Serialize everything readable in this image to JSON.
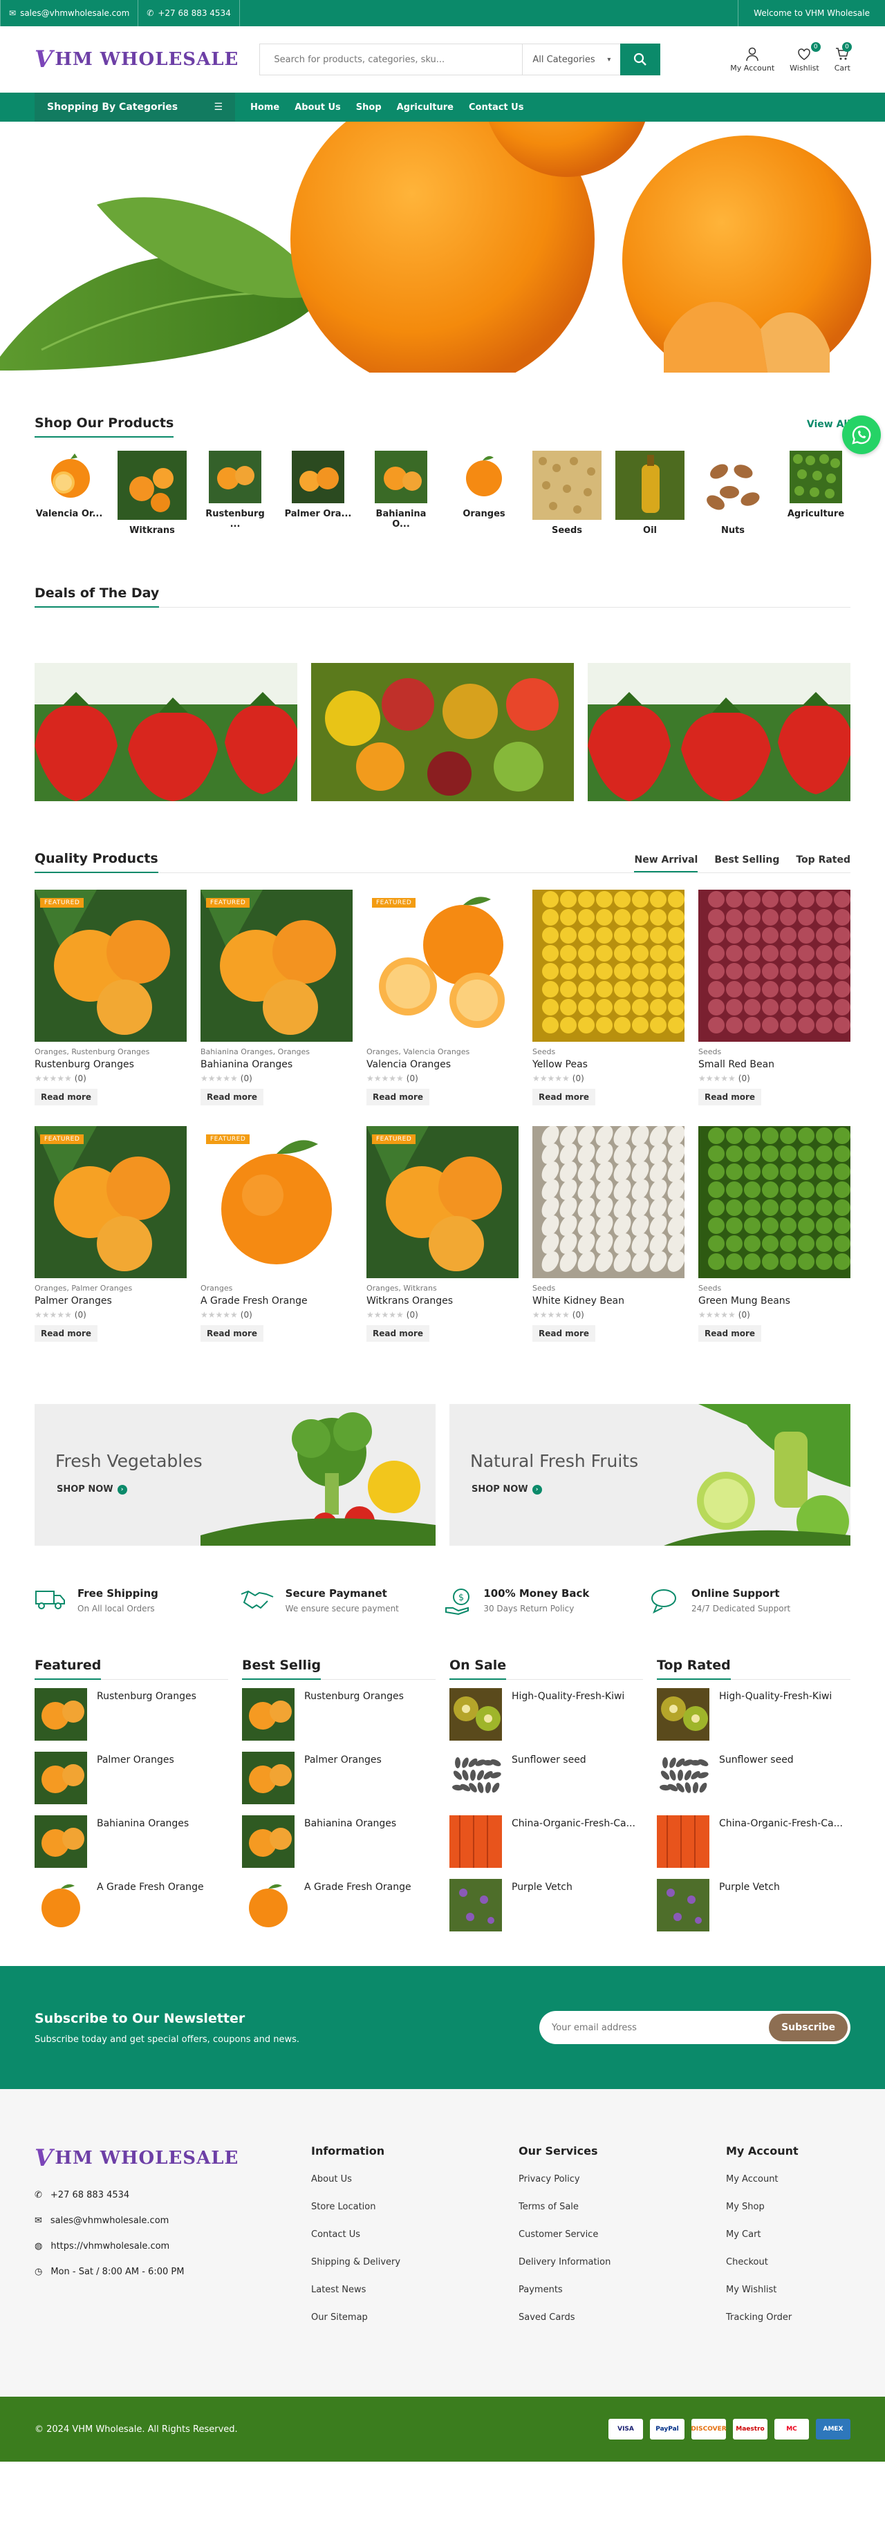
{
  "topbar": {
    "email": "sales@vhmwholesale.com",
    "phone": "+27 68 883 4534",
    "welcome": "Welcome to VHM Wholesale"
  },
  "header": {
    "logo_text": "HM WHOLESALE",
    "logo_initial": "V",
    "search_placeholder": "Search for products, categories, sku...",
    "category_select": "All Categories",
    "account_label": "My Account",
    "wishlist_label": "Wishlist",
    "wishlist_count": "0",
    "cart_label": "Cart",
    "cart_count": "0"
  },
  "nav": {
    "categories_button": "Shopping By Categories",
    "links": [
      "Home",
      "About Us",
      "Shop",
      "Agriculture",
      "Contact Us"
    ]
  },
  "shop_products": {
    "title": "Shop Our Products",
    "view_all": "View All",
    "items": [
      {
        "label": "Valencia Or...",
        "img": "orange-halves"
      },
      {
        "label": "Witkrans",
        "img": "orange-tree"
      },
      {
        "label": "Rustenburg ...",
        "img": "orange-tree"
      },
      {
        "label": "Palmer Ora...",
        "img": "orange-tree"
      },
      {
        "label": "Bahianina O...",
        "img": "orange-tree"
      },
      {
        "label": "Oranges",
        "img": "single-orange"
      },
      {
        "label": "Seeds",
        "img": "seeds"
      },
      {
        "label": "Oil",
        "img": "oil"
      },
      {
        "label": "Nuts",
        "img": "nuts"
      },
      {
        "label": "Agriculture",
        "img": "peas"
      }
    ]
  },
  "deals": {
    "title": "Deals of The Day"
  },
  "quality": {
    "title": "Quality Products",
    "tabs": [
      "New Arrival",
      "Best Selling",
      "Top Rated"
    ],
    "products": [
      {
        "featured": "FEATURED",
        "cats": "Oranges, Rustenburg Oranges",
        "name": "Rustenburg Oranges",
        "reviews": "(0)",
        "button": "Read more",
        "img": "tree"
      },
      {
        "featured": "FEATURED",
        "cats": "Bahianina Oranges, Oranges",
        "name": "Bahianina Oranges",
        "reviews": "(0)",
        "button": "Read more",
        "img": "tree"
      },
      {
        "featured": "FEATURED",
        "cats": "Oranges, Valencia Oranges",
        "name": "Valencia Oranges",
        "reviews": "(0)",
        "button": "Read more",
        "img": "halves"
      },
      {
        "featured": "",
        "cats": "Seeds",
        "name": "Yellow Peas",
        "reviews": "(0)",
        "button": "Read more",
        "img": "yellowpeas"
      },
      {
        "featured": "",
        "cats": "Seeds",
        "name": "Small Red Bean",
        "reviews": "(0)",
        "button": "Read more",
        "img": "redbean"
      },
      {
        "featured": "FEATURED",
        "cats": "Oranges, Palmer Oranges",
        "name": "Palmer Oranges",
        "reviews": "(0)",
        "button": "Read more",
        "img": "tree"
      },
      {
        "featured": "FEATURED",
        "cats": "Oranges",
        "name": "A Grade Fresh Orange",
        "reviews": "(0)",
        "button": "Read more",
        "img": "single"
      },
      {
        "featured": "FEATURED",
        "cats": "Oranges, Witkrans",
        "name": "Witkrans Oranges",
        "reviews": "(0)",
        "button": "Read more",
        "img": "tree"
      },
      {
        "featured": "",
        "cats": "Seeds",
        "name": "White Kidney Bean",
        "reviews": "(0)",
        "button": "Read more",
        "img": "whitebean"
      },
      {
        "featured": "",
        "cats": "Seeds",
        "name": "Green Mung Beans",
        "reviews": "(0)",
        "button": "Read more",
        "img": "greenbean"
      }
    ]
  },
  "promos": [
    {
      "title": "Fresh Vegetables",
      "button": "SHOP NOW"
    },
    {
      "title": "Natural Fresh Fruits",
      "button": "SHOP NOW"
    }
  ],
  "features": [
    {
      "title": "Free Shipping",
      "sub": "On All local Orders",
      "icon": "truck-icon"
    },
    {
      "title": "Secure Paymanet",
      "sub": "We ensure secure payment",
      "icon": "handshake-icon"
    },
    {
      "title": "100% Money Back",
      "sub": "30 Days Return Policy",
      "icon": "money-back-icon"
    },
    {
      "title": "Online Support",
      "sub": "24/7 Dedicated Support",
      "icon": "chat-icon"
    }
  ],
  "lists": [
    {
      "title": "Featured",
      "items": [
        "Rustenburg Oranges",
        "Palmer Oranges",
        "Bahianina Oranges",
        "A Grade Fresh Orange"
      ]
    },
    {
      "title": "Best Sellig",
      "items": [
        "Rustenburg Oranges",
        "Palmer Oranges",
        "Bahianina Oranges",
        "A Grade Fresh Orange"
      ]
    },
    {
      "title": "On Sale",
      "items": [
        "High-Quality-Fresh-Kiwi",
        "Sunflower seed",
        "China-Organic-Fresh-Ca...",
        "Purple Vetch"
      ]
    },
    {
      "title": "Top Rated",
      "items": [
        "High-Quality-Fresh-Kiwi",
        "Sunflower seed",
        "China-Organic-Fresh-Ca...",
        "Purple Vetch"
      ]
    }
  ],
  "newsletter": {
    "title": "Subscribe to Our Newsletter",
    "subtitle": "Subscribe today and get special offers, coupons and news.",
    "placeholder": "Your email address",
    "button": "Subscribe"
  },
  "footer": {
    "phone": "+27 68 883 4534",
    "email": "sales@vhmwholesale.com",
    "website": "https://vhmwholesale.com",
    "hours": "Mon - Sat / 8:00 AM - 6:00 PM",
    "columns": [
      {
        "title": "Information",
        "links": [
          "About Us",
          "Store Location",
          "Contact Us",
          "Shipping & Delivery",
          "Latest News",
          "Our Sitemap"
        ]
      },
      {
        "title": "Our Services",
        "links": [
          "Privacy Policy",
          "Terms of Sale",
          "Customer Service",
          "Delivery Information",
          "Payments",
          "Saved Cards"
        ]
      },
      {
        "title": "My Account",
        "links": [
          "My Account",
          "My Shop",
          "My Cart",
          "Checkout",
          "My Wishlist",
          "Tracking Order"
        ]
      }
    ],
    "copyright": "© 2024 VHM Wholesale. All Rights Reserved.",
    "payments": [
      "VISA",
      "PayPal",
      "DISCOVER",
      "Maestro",
      "MC",
      "AMEX"
    ]
  },
  "colors": {
    "brand": "#0b8a6a",
    "logo": "#6d3fa6",
    "footer_bar": "#3b7d1e",
    "featured": "#f39c12"
  }
}
